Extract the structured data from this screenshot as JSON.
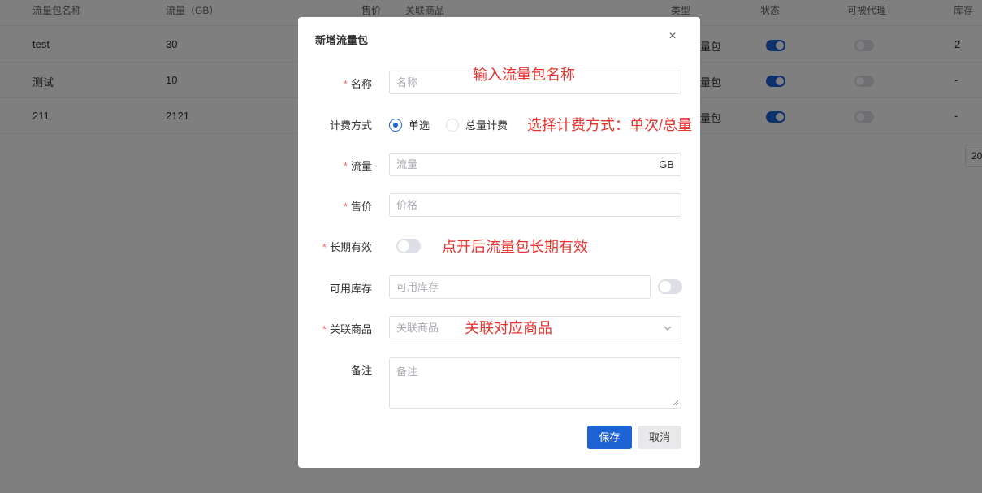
{
  "table": {
    "headers": [
      "流量包名称",
      "流量（GB）",
      "售价",
      "关联商品",
      "类型",
      "状态",
      "可被代理",
      "库存"
    ],
    "rows": [
      {
        "name": "test",
        "traffic": "30",
        "type": "量包",
        "status_on": true,
        "proxy_on": false,
        "stock": "2"
      },
      {
        "name": "测试",
        "traffic": "10",
        "type": "量包",
        "status_on": true,
        "proxy_on": false,
        "stock": "-"
      },
      {
        "name": "211",
        "traffic": "2121",
        "type": "量包",
        "status_on": true,
        "proxy_on": false,
        "stock": "-"
      }
    ],
    "pager_size": "20"
  },
  "dialog": {
    "title": "新增流量包",
    "close_icon": "×",
    "fields": {
      "name": {
        "label": "名称",
        "required": "*",
        "placeholder": "名称",
        "value": ""
      },
      "billing": {
        "label": "计费方式",
        "options": [
          "单选",
          "总量计费"
        ],
        "selected": "单选"
      },
      "traffic": {
        "label": "流量",
        "required": "*",
        "placeholder": "流量",
        "suffix": "GB",
        "value": ""
      },
      "price": {
        "label": "售价",
        "required": "*",
        "placeholder": "价格",
        "value": ""
      },
      "long_term": {
        "label": "长期有效",
        "required": "*",
        "enabled": false
      },
      "stock": {
        "label": "可用库存",
        "placeholder": "可用库存",
        "value": "",
        "toggle_enabled": false
      },
      "product": {
        "label": "关联商品",
        "required": "*",
        "placeholder": "关联商品",
        "value": ""
      },
      "remark": {
        "label": "备注",
        "placeholder": "备注",
        "value": ""
      }
    },
    "buttons": {
      "save": "保存",
      "cancel": "取消"
    },
    "annotations": {
      "name": "输入流量包名称",
      "billing": "选择计费方式：单次/总量",
      "long_term": "点开后流量包长期有效",
      "product": "关联对应商品"
    }
  },
  "colors": {
    "primary": "#1e63d6",
    "annotation": "#e8332f",
    "required": "#f56c6c"
  }
}
